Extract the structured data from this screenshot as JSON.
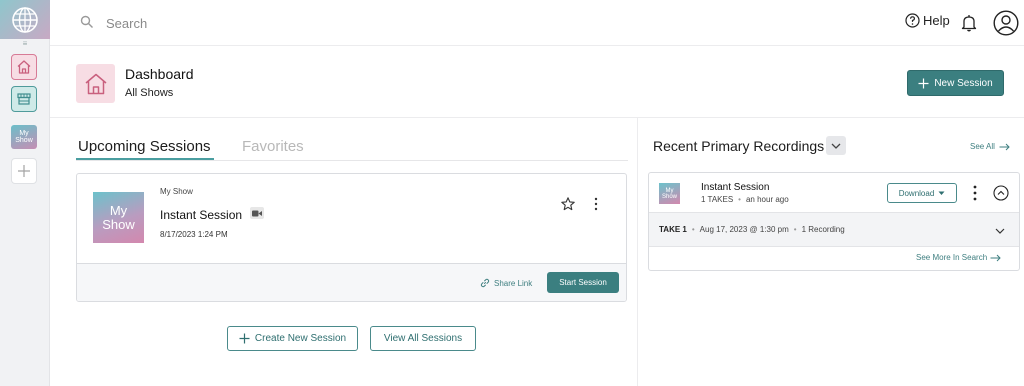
{
  "sidebar": {
    "show_tile": {
      "line1": "My",
      "line2": "Show"
    }
  },
  "search": {
    "placeholder": "Search",
    "value": ""
  },
  "topbar": {
    "help_label": "Help"
  },
  "header": {
    "title": "Dashboard",
    "subtitle": "All Shows",
    "new_session_label": "New Session"
  },
  "tabs": {
    "upcoming": "Upcoming Sessions",
    "favorites": "Favorites"
  },
  "session": {
    "thumb_line1": "My",
    "thumb_line2": "Show",
    "show_name": "My Show",
    "title": "Instant Session",
    "datetime": "8/17/2023 1:24 PM",
    "share_link_label": "Share Link",
    "start_label": "Start Session"
  },
  "actions": {
    "create_label": "Create New Session",
    "view_all_label": "View All Sessions"
  },
  "recent": {
    "title": "Recent Primary Recordings",
    "see_all_label": "See All",
    "item": {
      "thumb_line1": "My",
      "thumb_line2": "Show",
      "title": "Instant Session",
      "takes": "1 TAKES",
      "time": "an hour ago",
      "download_label": "Download"
    },
    "take": {
      "label": "TAKE 1",
      "date": "Aug 17, 2023 @ 1:30 pm",
      "recordings": "1 Recording"
    },
    "see_more_label": "See More In Search"
  },
  "colors": {
    "accent": "#3b7f80",
    "home_tint": "#f7dde4",
    "store_tint": "#cfeae8"
  },
  "icons": [
    "globe-icon",
    "home-icon",
    "storefront-icon",
    "plus-icon",
    "search-icon",
    "help-icon",
    "bell-icon",
    "user-icon",
    "video-camera-icon",
    "star-icon",
    "kebab-icon",
    "link-icon",
    "arrow-right-icon",
    "chevron-down-icon",
    "chevron-up-icon"
  ]
}
